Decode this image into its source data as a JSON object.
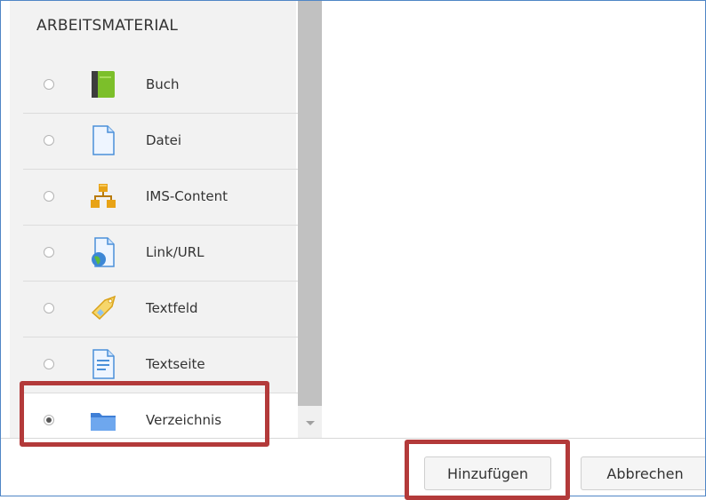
{
  "section": {
    "title": "ARBEITSMATERIAL"
  },
  "modules": [
    {
      "label": "Buch",
      "icon": "book-icon",
      "selected": false
    },
    {
      "label": "Datei",
      "icon": "file-icon",
      "selected": false
    },
    {
      "label": "IMS-Content",
      "icon": "ims-package-icon",
      "selected": false
    },
    {
      "label": "Link/URL",
      "icon": "url-globe-icon",
      "selected": false
    },
    {
      "label": "Textfeld",
      "icon": "label-tag-icon",
      "selected": false
    },
    {
      "label": "Textseite",
      "icon": "page-icon",
      "selected": false
    },
    {
      "label": "Verzeichnis",
      "icon": "folder-icon",
      "selected": true
    }
  ],
  "buttons": {
    "add": "Hinzufügen",
    "cancel": "Abbrechen"
  },
  "colors": {
    "highlight": "#b33a3a",
    "frame_border": "#4f86c6",
    "panel_bg": "#f2f2f2"
  }
}
